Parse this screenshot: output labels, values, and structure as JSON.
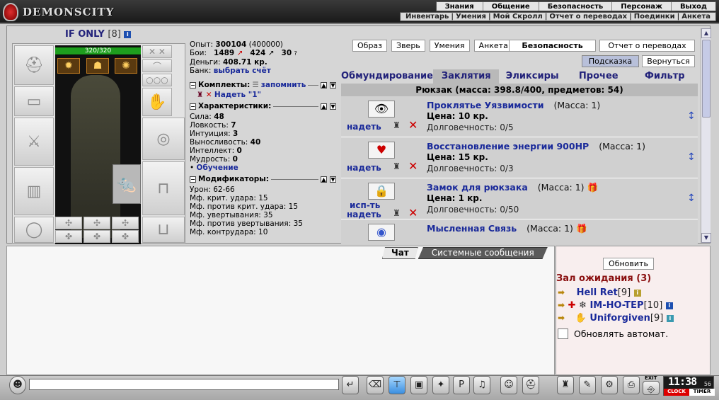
{
  "top_menu": [
    "Знания",
    "Общение",
    "Безопасность",
    "Персонаж",
    "Выход"
  ],
  "sub_menu": [
    "Инвентарь",
    "Умения",
    "Мой Скролл",
    "Отчет о переводах",
    "Поединки",
    "Анкета"
  ],
  "logo_text": "DEMONSCITY",
  "character": {
    "name": "IF ONLY",
    "level": "[8]"
  },
  "hp": "320/320",
  "stats": {
    "exp_label": "Опыт:",
    "exp": "300104",
    "exp_next": "(400000)",
    "fights_label": "Бои:",
    "wins": "1489",
    "losses": "424",
    "draws": "30",
    "money_label": "Деньги:",
    "money": "408.71 кр.",
    "bank_label": "Банк:",
    "bank_link": "выбрать счёт",
    "sets_label": "Комплекты:",
    "sets_remember": "запомнить",
    "sets_wear": "Надеть \"1\"",
    "chars_label": "Характеристики:",
    "char_rows": [
      {
        "label": "Сила:",
        "value": "48"
      },
      {
        "label": "Ловкость:",
        "value": "7"
      },
      {
        "label": "Интуиция:",
        "value": "3"
      },
      {
        "label": "Выносливость:",
        "value": "40"
      },
      {
        "label": "Интеллект:",
        "value": "0"
      },
      {
        "label": "Мудрость:",
        "value": "0"
      }
    ],
    "training": "Обучение",
    "mods_label": "Модификаторы:",
    "mod_rows": [
      "Урон: 62-66",
      "Мф. крит. удара: 15",
      "Мф. против крит. удара: 15",
      "Мф. увертывания: 35",
      "Мф. против увертывания: 35",
      "Мф. контрудара: 10"
    ]
  },
  "buttons": {
    "obraz": "Образ",
    "zver": "Зверь",
    "umeniya": "Умения",
    "anketa": "Анкета",
    "security": "Безопасность",
    "transfers": "Отчет о переводах",
    "hint": "Подсказка",
    "back": "Вернуться"
  },
  "tabs": [
    "Обмундирование",
    "Заклятия",
    "Эликсиры",
    "Прочее",
    "Фильтр"
  ],
  "active_tab": "Заклятия",
  "backpack": "Рюкзак (масса: 398.8/400, предметов: 54)",
  "items": [
    {
      "name": "Проклятье Уязвимости",
      "mass": "(Масса: 1)",
      "price": "Цена: 10 кр.",
      "durability": "Долговечность: 0/5",
      "action": "надеть",
      "icon": "eye-scroll-icon",
      "icon_glyph": "👁"
    },
    {
      "name": "Восстановление энергии 900HP",
      "mass": "(Масса: 1)",
      "price": "Цена: 15 кр.",
      "durability": "Долговечность: 0/3",
      "action": "надеть",
      "icon": "heart-scroll-icon",
      "icon_glyph": "♥"
    },
    {
      "name": "Замок для рюкзака",
      "mass": "(Масса: 1)",
      "price": "Цена: 1 кр.",
      "durability": "Долговечность: 0/50",
      "action": "исп-ть",
      "action2": "надеть",
      "icon": "lock-scroll-icon",
      "icon_glyph": "🔒"
    },
    {
      "name": "Мысленная Связь",
      "mass": "(Масса: 1)",
      "icon": "orb-scroll-icon",
      "icon_glyph": "◉"
    }
  ],
  "chat_tabs": [
    "Чат",
    "Системные сообщения"
  ],
  "side": {
    "refresh": "Обновить",
    "waiting": "Зал ожидания (3)",
    "users": [
      {
        "name": "Hell Ret",
        "level": "[9]"
      },
      {
        "name": "IM-HO-TEP",
        "level": "[10]"
      },
      {
        "name": "Uniforgiven",
        "level": "[9]"
      }
    ],
    "auto": "Обновлять автомат."
  },
  "clock": {
    "time": "11:38",
    "sec": "56",
    "label1": "CLOCK",
    "label2": "TIMER"
  },
  "exit_label": "EXIT"
}
